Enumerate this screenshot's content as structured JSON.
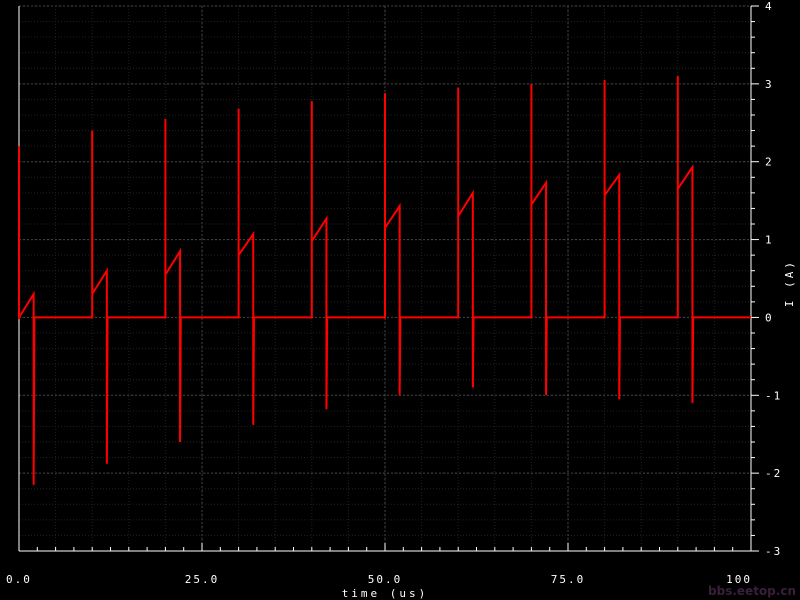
{
  "chart_data": {
    "type": "line",
    "title": "",
    "xlabel": "time (us)",
    "ylabel": "I (A)",
    "xlim": [
      0,
      100
    ],
    "ylim": [
      -3,
      4
    ],
    "x_ticks": [
      0,
      25,
      50,
      75,
      100
    ],
    "x_tick_labels": [
      "0.0",
      "25.0",
      "50.0",
      "75.0",
      "100"
    ],
    "y_ticks": [
      -3,
      -2,
      -1,
      0,
      1,
      2,
      3,
      4
    ],
    "y_tick_labels": [
      "-3",
      "-2",
      "-1",
      "0",
      "1",
      "2",
      "3",
      "4"
    ],
    "y_axis_side": "right",
    "grid": true,
    "background_color": "#000000",
    "grid_color": "#444444",
    "series_color": "#ff0000",
    "series": [
      {
        "x": [
          0,
          0,
          0,
          2,
          2,
          2.1,
          2.1,
          10,
          10,
          10,
          12,
          12,
          12.1,
          12.1,
          20,
          20,
          20,
          22,
          22,
          22.1,
          22.1,
          30,
          30,
          30,
          32,
          32,
          32.1,
          32.1,
          40,
          40,
          40,
          42,
          42,
          42.1,
          42.1,
          50,
          50,
          50,
          52,
          52,
          52.1,
          52.1,
          60,
          60,
          60,
          62,
          62,
          62.1,
          62.1,
          70,
          70,
          70,
          72,
          72,
          72.1,
          72.1,
          80,
          80,
          80,
          82,
          82,
          82.1,
          82.1,
          90,
          90,
          90,
          92,
          92,
          92.1,
          92.1,
          100
        ],
        "y": [
          0,
          2.2,
          0,
          0.3,
          -2.15,
          0,
          0,
          0,
          2.4,
          0.3,
          0.6,
          -1.88,
          0,
          0,
          0,
          2.55,
          0.55,
          0.85,
          -1.6,
          0,
          0,
          0,
          2.68,
          0.8,
          1.07,
          -1.38,
          0,
          0,
          0,
          2.78,
          0.98,
          1.27,
          -1.18,
          0,
          0,
          0,
          2.88,
          1.15,
          1.43,
          -1.0,
          0,
          0,
          0,
          2.95,
          1.3,
          1.6,
          -0.9,
          0,
          0,
          0,
          3.0,
          1.45,
          1.73,
          -1.0,
          0,
          0,
          0,
          3.05,
          1.57,
          1.83,
          -1.05,
          0,
          0,
          0,
          3.1,
          1.65,
          1.93,
          -1.1,
          0,
          0,
          0
        ]
      }
    ]
  },
  "watermark": "bbs.eetop.cn"
}
